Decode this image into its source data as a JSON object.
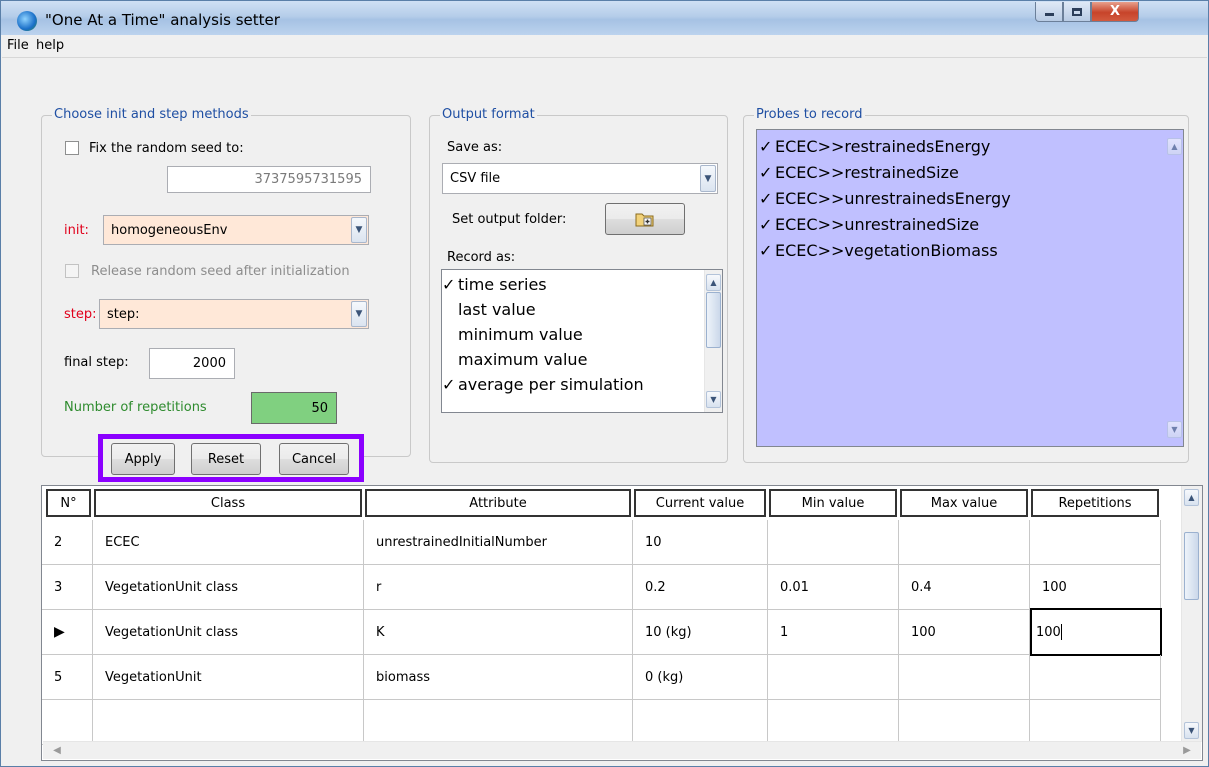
{
  "window": {
    "title": "\"One At a Time\" analysis setter",
    "controls": {
      "minimize": "minimize",
      "maximize": "maximize",
      "close": "X"
    }
  },
  "menu": [
    "File",
    "help"
  ],
  "init_group": {
    "legend": "Choose init and step methods",
    "fix_seed_label": "Fix the random seed to:",
    "fix_seed_checked": false,
    "seed_value": "3737595731595",
    "init_label": "init:",
    "init_value": "homogeneousEnv",
    "release_seed_label": "Release random seed after initialization",
    "step_label": "step:",
    "step_value": "step:",
    "final_step_label": "final step:",
    "final_step_value": "2000",
    "repetitions_label": "Number of repetitions",
    "repetitions_value": "50",
    "colors": {
      "required_label": "#e0001b",
      "repetitions_label": "#2e8b2e",
      "repetitions_field": "#80d080",
      "combo_bg": "#ffe8d8"
    }
  },
  "action_buttons": {
    "apply": "Apply",
    "reset": "Reset",
    "cancel": "Cancel",
    "highlight": "#8b00ff"
  },
  "output_group": {
    "legend": "Output format",
    "save_as_label": "Save as:",
    "save_as_value": "CSV file",
    "output_folder_label": "Set output folder:",
    "folder_button_icon": "folder-add-icon",
    "record_as_label": "Record as:",
    "record_items": [
      {
        "label": "time series",
        "checked": true
      },
      {
        "label": "last value",
        "checked": false
      },
      {
        "label": "minimum value",
        "checked": false
      },
      {
        "label": "maximum value",
        "checked": false
      },
      {
        "label": "average per simulation",
        "checked": true
      }
    ]
  },
  "probes_group": {
    "legend": "Probes to record",
    "items": [
      {
        "label": "ECEC>>restrainedsEnergy",
        "checked": true
      },
      {
        "label": "ECEC>>restrainedSize",
        "checked": true
      },
      {
        "label": "ECEC>>unrestrainedsEnergy",
        "checked": true
      },
      {
        "label": "ECEC>>unrestrainedSize",
        "checked": true
      },
      {
        "label": "ECEC>>vegetationBiomass",
        "checked": true
      }
    ],
    "bg": "#c0c0ff"
  },
  "table": {
    "headers": [
      "N°",
      "Class",
      "Attribute",
      "Current value",
      "Min value",
      "Max value",
      "Repetitions"
    ],
    "rows": [
      {
        "n": "2",
        "class": "ECEC",
        "attribute": "unrestrainedInitialNumber",
        "current": "10",
        "min": "",
        "max": "",
        "reps": ""
      },
      {
        "n": "3",
        "class": "VegetationUnit class",
        "attribute": "r",
        "current": "0.2",
        "min": "0.01",
        "max": "0.4",
        "reps": "100"
      },
      {
        "n": "▶",
        "class": "VegetationUnit class",
        "attribute": "K",
        "current": "10 (kg)",
        "min": "1",
        "max": "100",
        "reps": "100"
      },
      {
        "n": "5",
        "class": "VegetationUnit",
        "attribute": "biomass",
        "current": "0 (kg)",
        "min": "",
        "max": "",
        "reps": ""
      },
      {
        "n": "",
        "class": "",
        "attribute": "",
        "current": "",
        "min": "",
        "max": "",
        "reps": ""
      }
    ]
  }
}
